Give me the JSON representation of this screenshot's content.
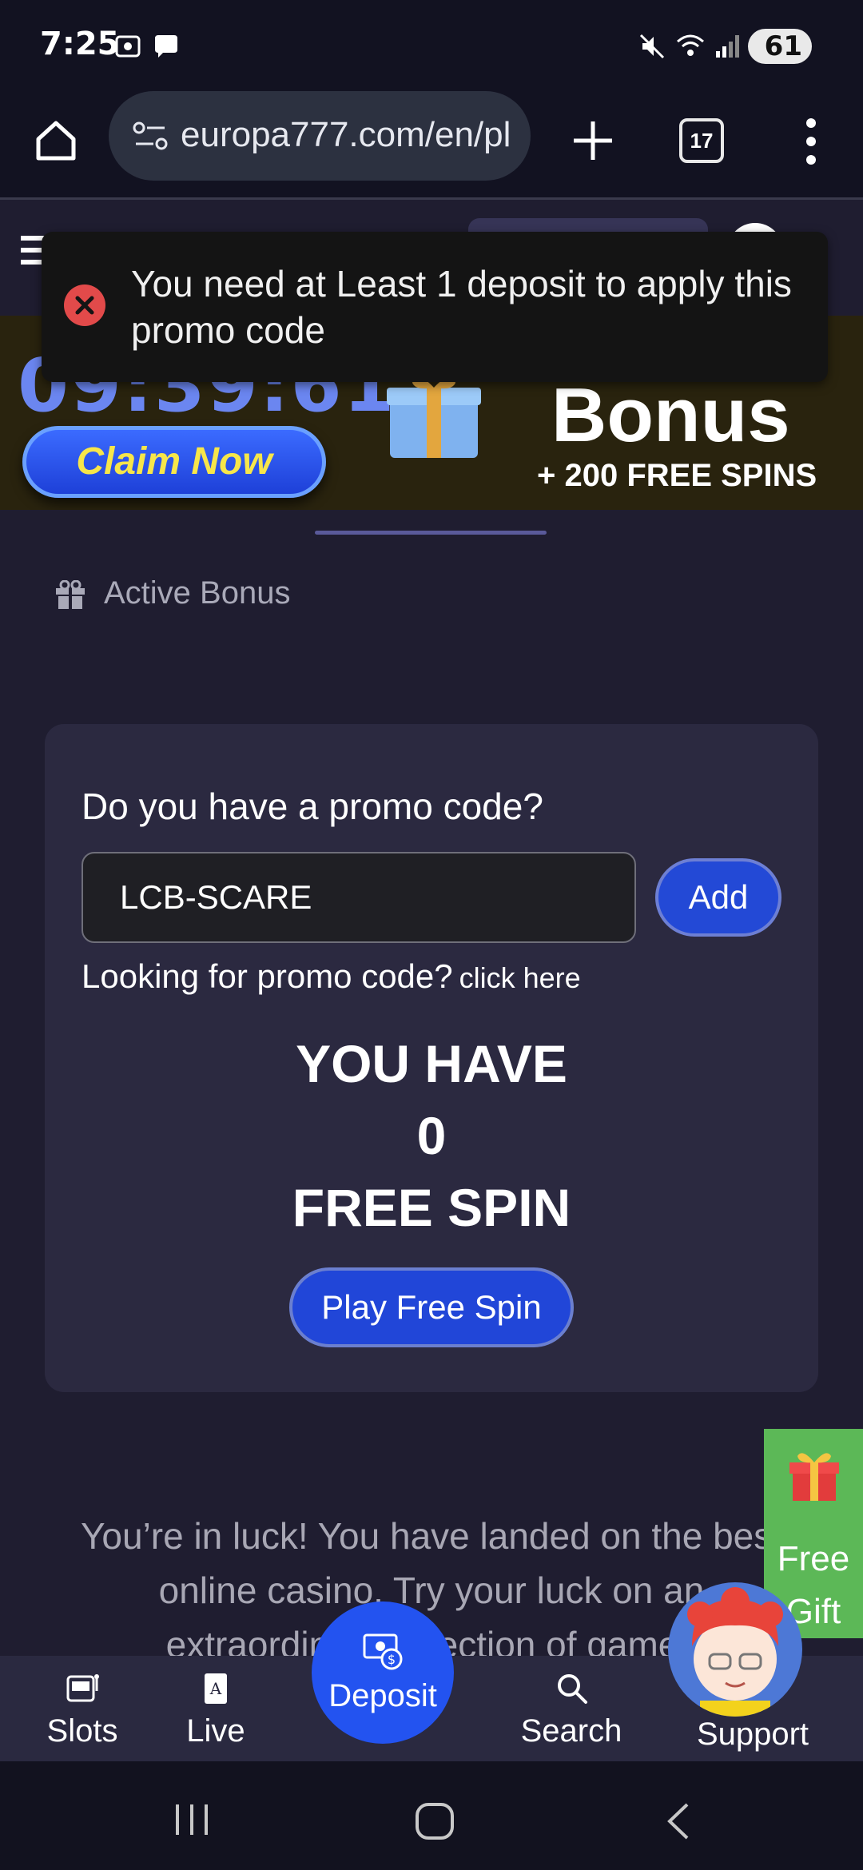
{
  "status_bar": {
    "time": "7:25",
    "battery": "61"
  },
  "browser": {
    "url": "europa777.com/en/pl",
    "tab_count": "17"
  },
  "toast": {
    "message": "You need at Least 1 deposit to apply this promo code"
  },
  "banner": {
    "countdown": "09:39:61",
    "claim_label": "Claim Now",
    "bonus_title": "Bonus",
    "bonus_subtitle": "+ 200 FREE SPINS"
  },
  "active_bonus": {
    "label": "Active Bonus"
  },
  "promo": {
    "question": "Do you have a promo code?",
    "input_value": "LCB-SCARE",
    "add_label": "Add",
    "looking_text": "Looking for promo code?",
    "click_here": "click here",
    "you_have": "YOU HAVE",
    "spin_count": "0",
    "free_spin": "FREE SPIN",
    "play_label": "Play Free Spin"
  },
  "lucky_text": "You’re in luck! You have landed on the best online casino. Try your luck on an extraordinary selection of games",
  "free_gift": {
    "line1": "Free",
    "line2": "Gift"
  },
  "bottom_nav": {
    "slots": "Slots",
    "live": "Live",
    "deposit": "Deposit",
    "search": "Search",
    "support": "Support"
  },
  "colors": {
    "accent": "#2353f0",
    "gift_green": "#5cb857",
    "claim_yellow": "#f7e64a",
    "error_red": "#e24a4a"
  }
}
